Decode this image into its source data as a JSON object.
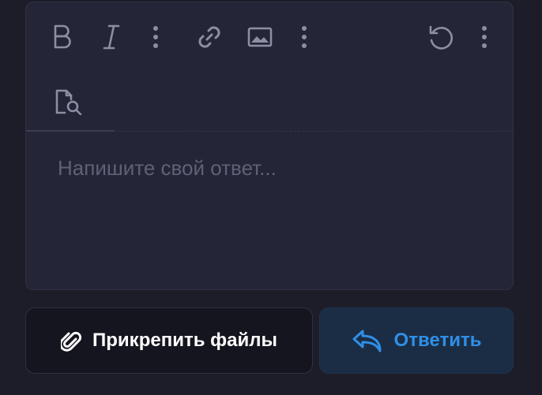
{
  "editor": {
    "placeholder": "Напишите свой ответ...",
    "toolbar": {
      "items": [
        {
          "name": "bold",
          "icon": "bold-icon"
        },
        {
          "name": "italic",
          "icon": "italic-icon"
        },
        {
          "name": "more-1",
          "icon": "more-vertical-icon"
        },
        {
          "name": "link",
          "icon": "link-icon"
        },
        {
          "name": "image",
          "icon": "image-icon"
        },
        {
          "name": "more-2",
          "icon": "more-vertical-icon"
        },
        {
          "name": "undo",
          "icon": "undo-icon"
        },
        {
          "name": "more-3",
          "icon": "more-vertical-icon"
        },
        {
          "name": "preview",
          "icon": "document-search-icon"
        }
      ]
    }
  },
  "actions": {
    "attach_label": "Прикрепить файлы",
    "reply_label": "Ответить"
  },
  "colors": {
    "background": "#1d1d29",
    "editor_bg": "#242536",
    "toolbar_icon": "#8c8fa4",
    "placeholder": "#5f6277",
    "reply_text": "#2f8fe6",
    "reply_bg": "#1b2d45",
    "attach_bg": "#15151f"
  }
}
